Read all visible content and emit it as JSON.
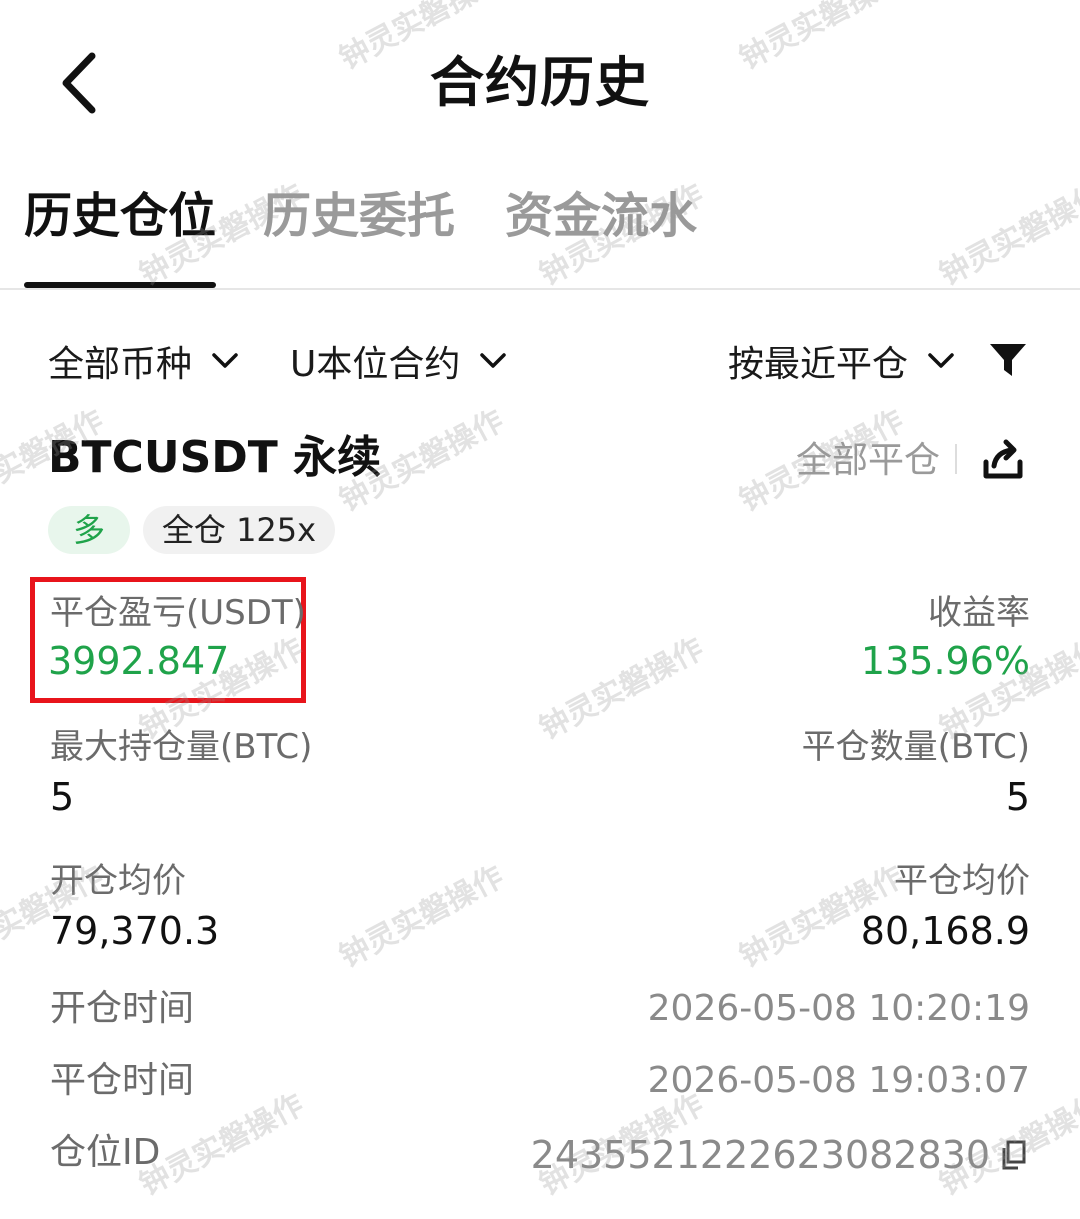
{
  "header": {
    "title": "合约历史",
    "back_icon": "chevron-left-icon"
  },
  "tabs": [
    {
      "label": "历史仓位",
      "active": true
    },
    {
      "label": "历史委托",
      "active": false
    },
    {
      "label": "资金流水",
      "active": false
    }
  ],
  "filters": {
    "coin": "全部币种",
    "contract": "U本位合约",
    "sort": "按最近平仓",
    "filter_icon": "funnel-icon"
  },
  "position": {
    "symbol": "BTCUSDT 永续",
    "close_all_label": "全部平仓",
    "share_icon": "share-icon",
    "side_badge": "多",
    "margin_badge": "全仓 125x",
    "pnl_label": "平仓盈亏(USDT)",
    "pnl_value": "3992.847",
    "roi_label": "收益率",
    "roi_value": "135.96%",
    "max_pos_label": "最大持仓量(BTC)",
    "max_pos_value": "5",
    "close_qty_label": "平仓数量(BTC)",
    "close_qty_value": "5",
    "open_avg_label": "开仓均价",
    "open_avg_value": "79,370.3",
    "close_avg_label": "平仓均价",
    "close_avg_value": "80,168.9",
    "open_time_label": "开仓时间",
    "open_time_value": "2026-05-08 10:20:19",
    "close_time_label": "平仓时间",
    "close_time_value": "2026-05-08 19:03:07",
    "pos_id_label": "仓位ID",
    "pos_id_value": "243552122262308283​0",
    "copy_icon": "copy-icon"
  },
  "watermark": {
    "text": "钟灵实磐操作"
  },
  "colors": {
    "green": "#1fa34a",
    "highlight_red": "#e8141b",
    "muted": "#9a9a9a"
  }
}
